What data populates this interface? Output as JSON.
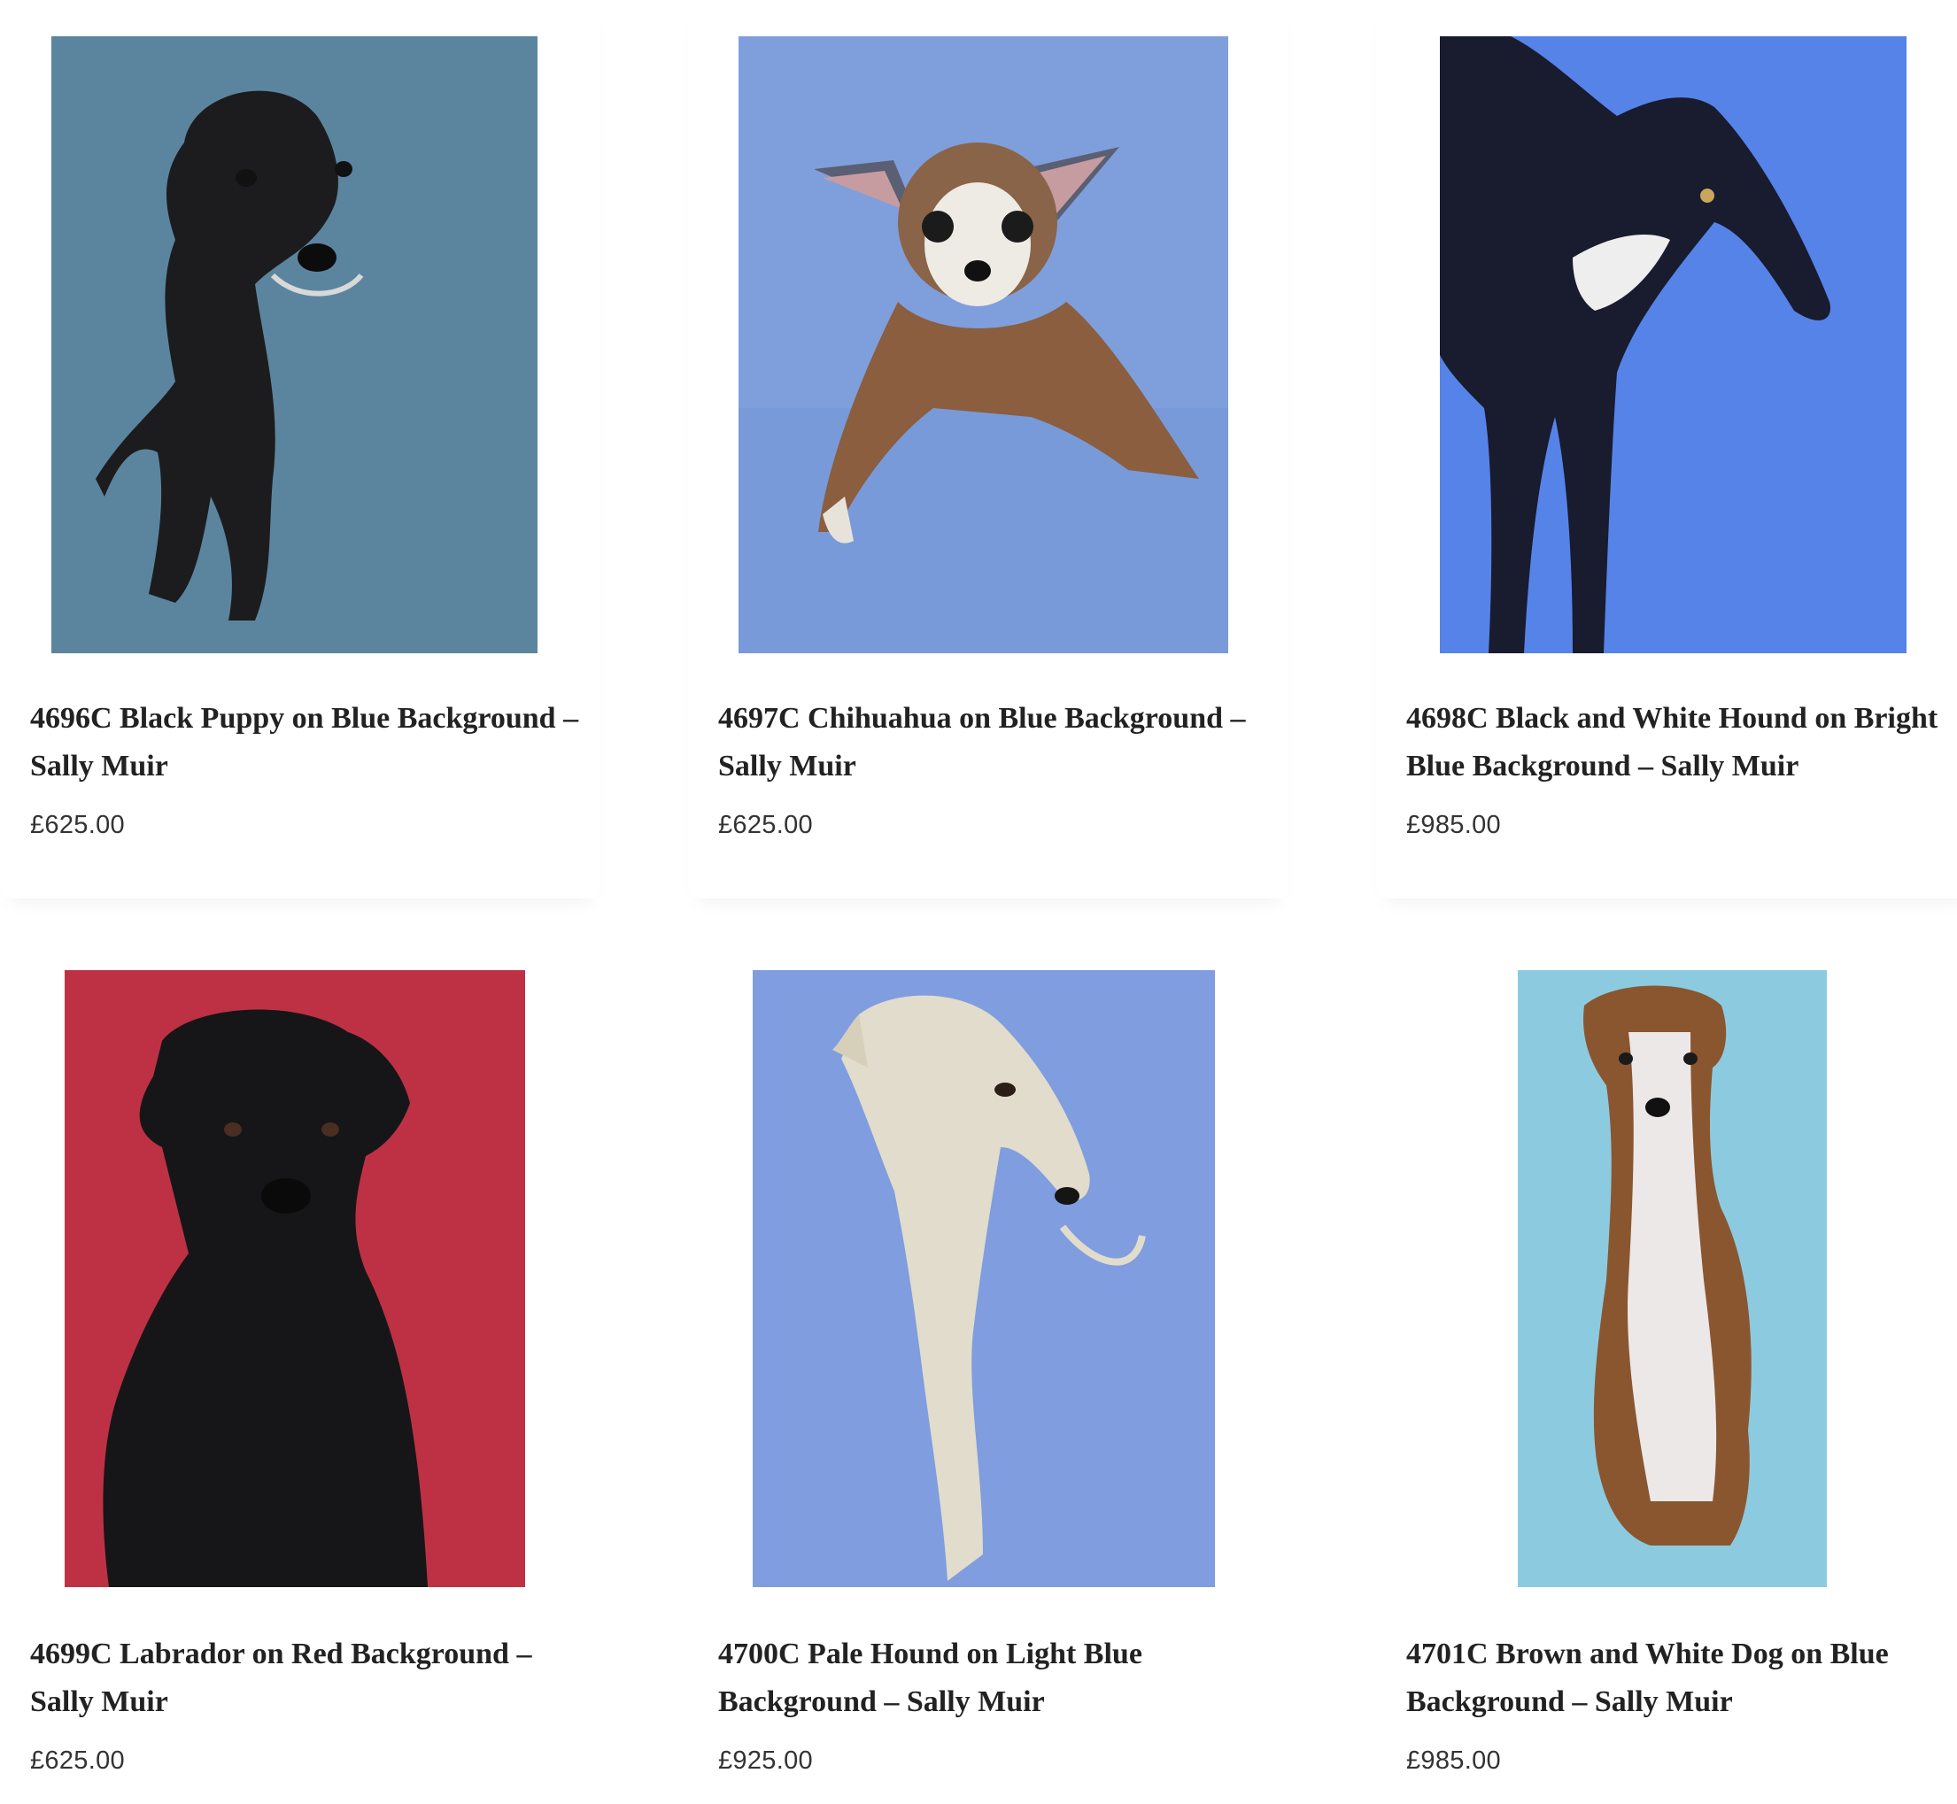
{
  "products": [
    {
      "title": "4696C Black Puppy on Blue Background – Sally Muir",
      "price": "£625.00",
      "background_color": "#5f88a2",
      "image": "black-puppy-painting"
    },
    {
      "title": "4697C Chihuahua on Blue Background – Sally Muir",
      "price": "£625.00",
      "background_color": "#7f9fdc",
      "image": "chihuahua-painting"
    },
    {
      "title": "4698C Black and White Hound on Bright Blue Background – Sally Muir",
      "price": "£985.00",
      "background_color": "#5683e8",
      "image": "black-white-hound-painting"
    },
    {
      "title": "4699C Labrador on Red Background – Sally Muir",
      "price": "£625.00",
      "background_color": "#c33448",
      "image": "labrador-painting"
    },
    {
      "title": "4700C Pale Hound on Light Blue Background – Sally Muir",
      "price": "£925.00",
      "background_color": "#7f9ddf",
      "image": "pale-hound-painting"
    },
    {
      "title": "4701C Brown and White Dog on Blue Background – Sally Muir",
      "price": "£985.00",
      "background_color": "#8ccbdf",
      "image": "brown-white-dog-painting"
    }
  ]
}
